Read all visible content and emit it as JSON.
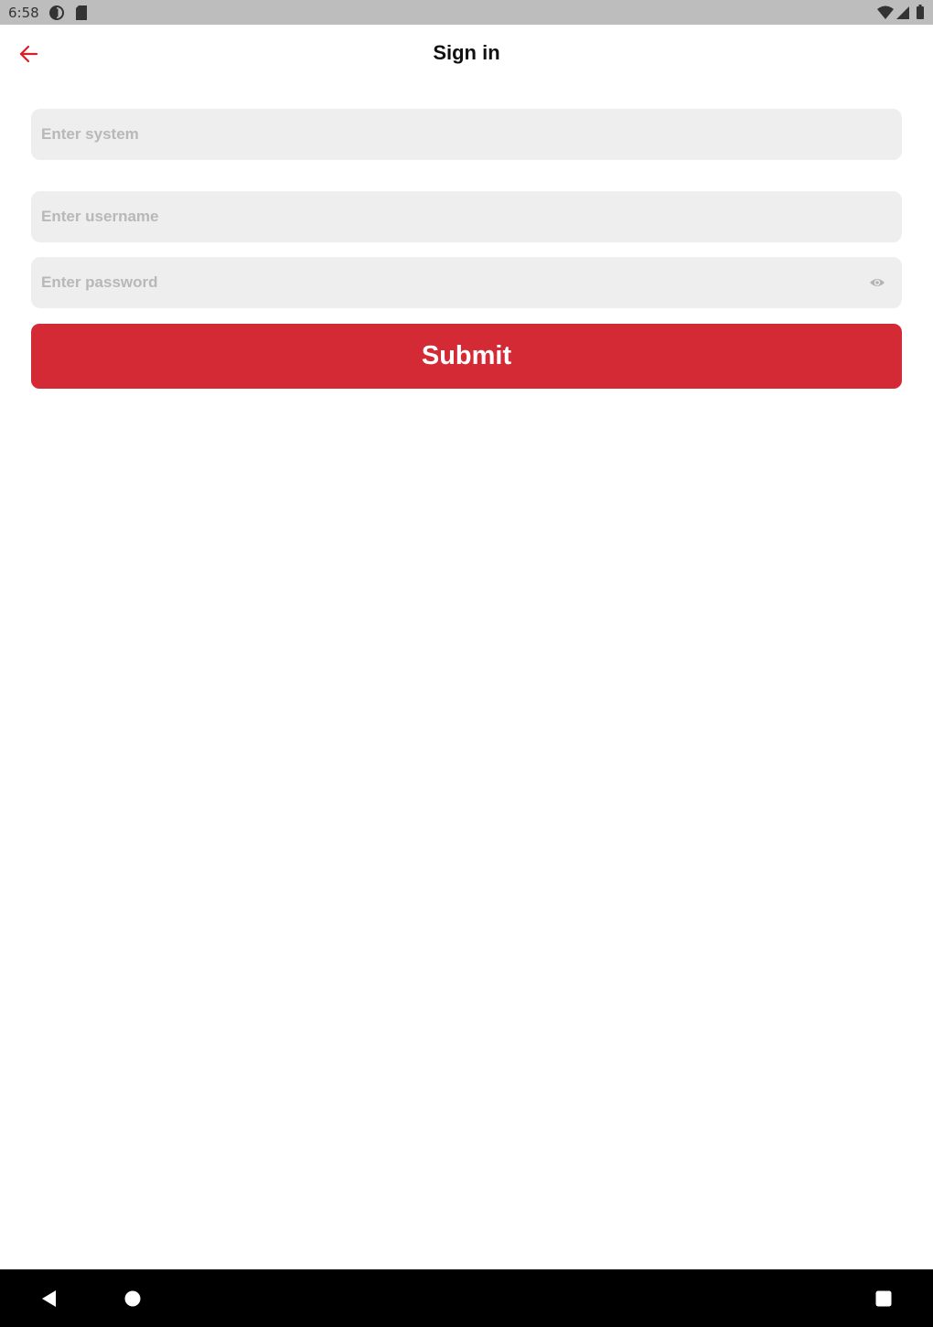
{
  "status_bar": {
    "time": "6:58",
    "icons_left": [
      "data-saver-icon",
      "sd-card-icon"
    ],
    "icons_right": [
      "wifi-icon",
      "cell-signal-icon",
      "battery-icon"
    ]
  },
  "app_bar": {
    "title": "Sign in",
    "back_icon": "arrow-back-icon"
  },
  "form": {
    "system_placeholder": "Enter system",
    "system_value": "",
    "username_placeholder": "Enter username",
    "username_value": "",
    "password_placeholder": "Enter password",
    "password_value": "",
    "password_toggle_icon": "eye-icon",
    "submit_label": "Submit"
  },
  "nav_bar": {
    "icons": [
      "back-triangle-icon",
      "home-circle-icon",
      "recents-square-icon"
    ]
  },
  "colors": {
    "accent": "#d32a36",
    "back_arrow": "#e01b24",
    "field_background": "#eeeeee",
    "placeholder": "#b8b8b8",
    "status_bar": "#bdbdbd",
    "nav_bar": "#000000"
  }
}
